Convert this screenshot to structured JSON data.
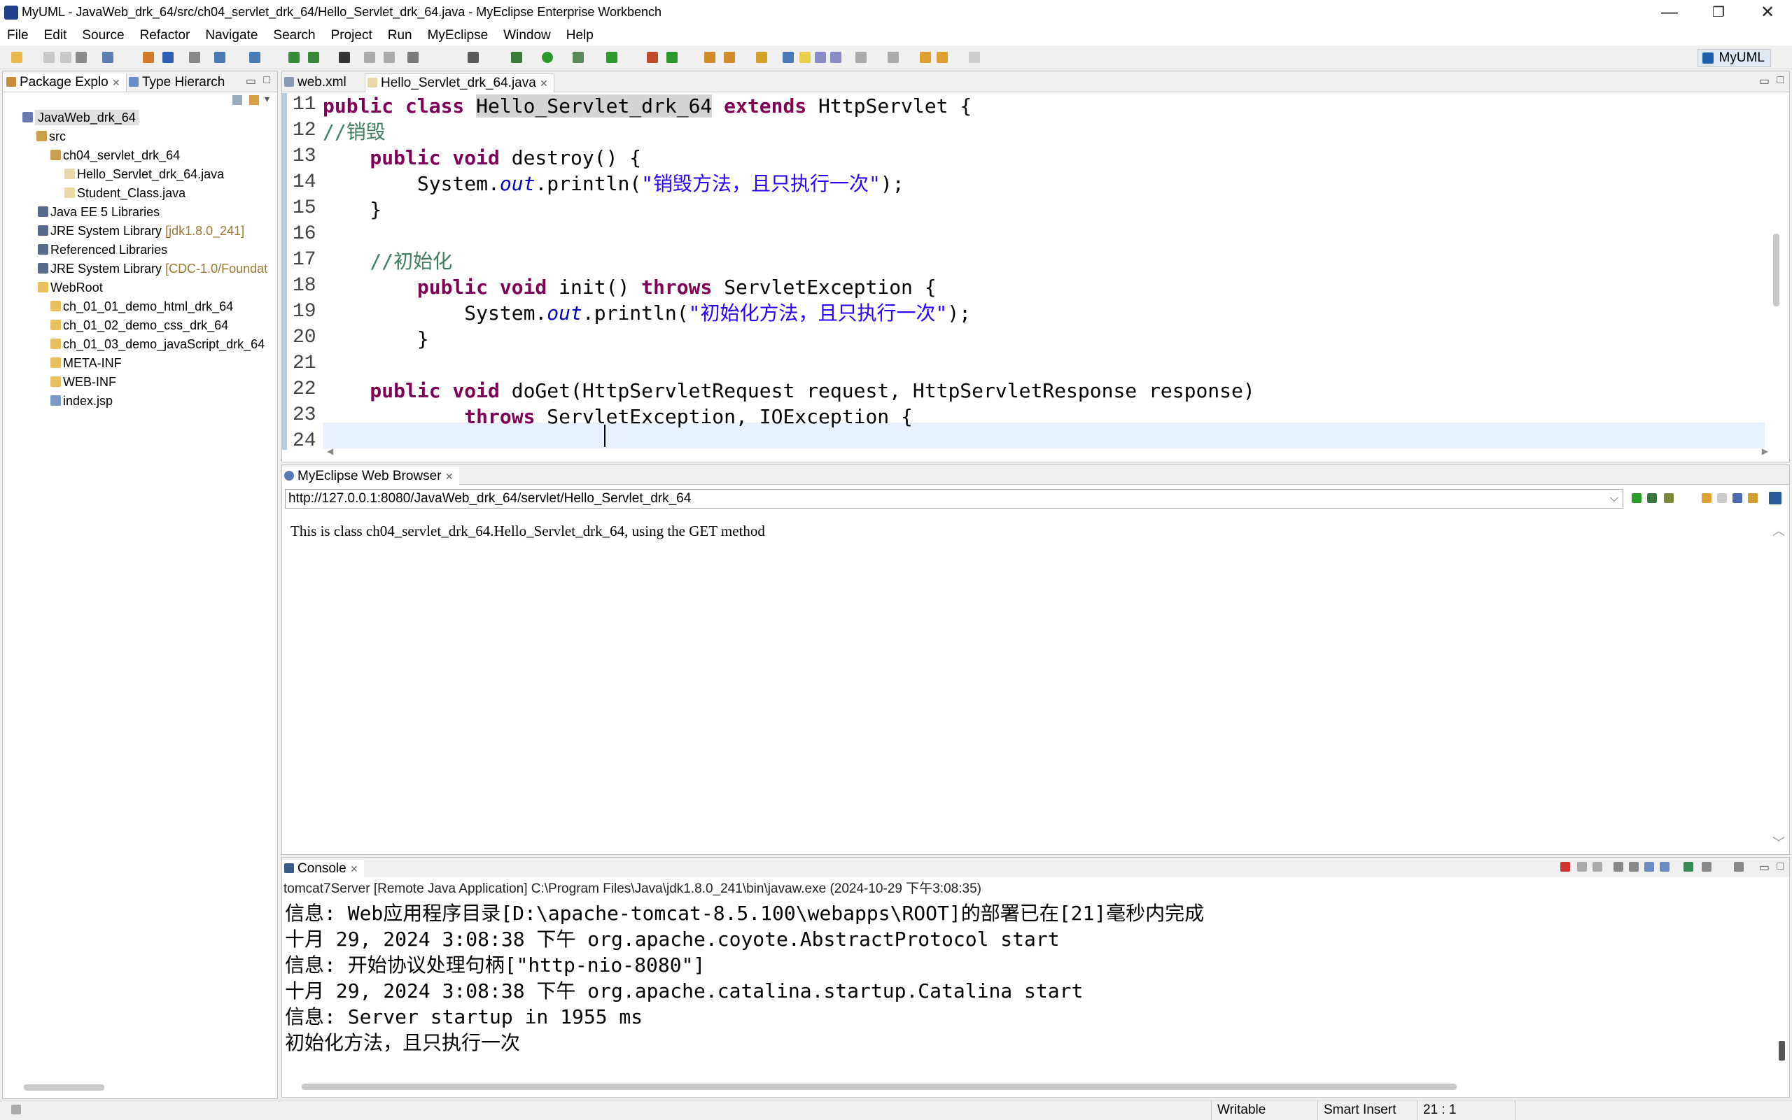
{
  "window": {
    "title": "MyUML - JavaWeb_drk_64/src/ch04_servlet_drk_64/Hello_Servlet_drk_64.java - MyEclipse Enterprise Workbench"
  },
  "menu": [
    "File",
    "Edit",
    "Source",
    "Refactor",
    "Navigate",
    "Search",
    "Project",
    "Run",
    "MyEclipse",
    "Window",
    "Help"
  ],
  "perspective": "MyUML",
  "left_panel": {
    "tabs": [
      "Package Explo",
      "Type Hierarch"
    ],
    "tree": [
      {
        "label": "JavaWeb_drk_64",
        "depth": 0
      },
      {
        "label": "src",
        "depth": 1
      },
      {
        "label": "ch04_servlet_drk_64",
        "depth": 2
      },
      {
        "label": "Hello_Servlet_drk_64.java",
        "depth": 3
      },
      {
        "label": "Student_Class.java",
        "depth": 3
      },
      {
        "label": "Java EE 5 Libraries",
        "depth": 1
      },
      {
        "label": "JRE System Library",
        "suffix": "[jdk1.8.0_241]",
        "depth": 1
      },
      {
        "label": "Referenced Libraries",
        "depth": 1
      },
      {
        "label": "JRE System Library",
        "suffix": "[CDC-1.0/Foundat",
        "depth": 1
      },
      {
        "label": "WebRoot",
        "depth": 1
      },
      {
        "label": "ch_01_01_demo_html_drk_64",
        "depth": 2
      },
      {
        "label": "ch_01_02_demo_css_drk_64",
        "depth": 2
      },
      {
        "label": "ch_01_03_demo_javaScript_drk_64",
        "depth": 2
      },
      {
        "label": "META-INF",
        "depth": 2
      },
      {
        "label": "WEB-INF",
        "depth": 2
      },
      {
        "label": "index.jsp",
        "depth": 2
      }
    ]
  },
  "editor": {
    "tabs": [
      "web.xml",
      "Hello_Servlet_drk_64.java"
    ],
    "line_numbers": [
      "11",
      "12",
      "13",
      "14",
      "15",
      "16",
      "17",
      "18",
      "19",
      "20",
      "21",
      "22",
      "23",
      "24"
    ],
    "code": {
      "l11_kw": "public class ",
      "l11_cls": "Hello_Servlet_drk_64",
      "l11_kw2": " extends ",
      "l11_rest": "HttpServlet {",
      "l12": "//销毁",
      "l13_kw": "    public void ",
      "l13_rest": "destroy() {",
      "l14_a": "        System.",
      "l14_b": "out",
      "l14_c": ".println(",
      "l14_str": "\"销毁方法，且只执行一次\"",
      "l14_d": ");",
      "l15": "    }",
      "l17": "    //初始化",
      "l18_kw": "        public void ",
      "l18_b": "init() ",
      "l18_kw2": "throws ",
      "l18_c": "ServletException {",
      "l19_a": "            System.",
      "l19_b": "out",
      "l19_c": ".println(",
      "l19_str": "\"初始化方法，且只执行一次\"",
      "l19_d": ");",
      "l20": "        }",
      "l22_kw": "    public void ",
      "l22_rest": "doGet(HttpServletRequest request, HttpServletResponse response)",
      "l23_kw": "            throws ",
      "l23_rest": "ServletException, IOException {"
    }
  },
  "browser": {
    "tab": "MyEclipse Web Browser",
    "url": "http://127.0.0.1:8080/JavaWeb_drk_64/servlet/Hello_Servlet_drk_64",
    "page_text": "This is class ch04_servlet_drk_64.Hello_Servlet_drk_64, using the GET method"
  },
  "console": {
    "tab": "Console",
    "description": "tomcat7Server [Remote Java Application] C:\\Program Files\\Java\\jdk1.8.0_241\\bin\\javaw.exe (2024-10-29 下午3:08:35)",
    "lines": [
      "信息: Web应用程序目录[D:\\apache-tomcat-8.5.100\\webapps\\ROOT]的部署已在[21]毫秒内完成",
      "十月 29, 2024 3:08:38 下午 org.apache.coyote.AbstractProtocol start",
      "信息: 开始协议处理句柄[\"http-nio-8080\"]",
      "十月 29, 2024 3:08:38 下午 org.apache.catalina.startup.Catalina start",
      "信息: Server startup in 1955 ms",
      "初始化方法，且只执行一次"
    ]
  },
  "status": {
    "writable": "Writable",
    "insert_mode": "Smart Insert",
    "position": "21 : 1"
  }
}
